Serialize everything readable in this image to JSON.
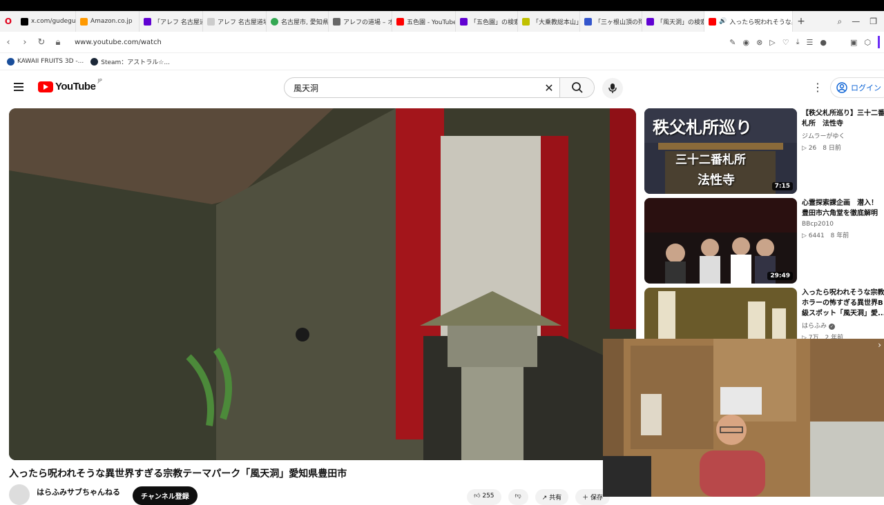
{
  "browser": {
    "tabs": [
      {
        "label": "x.com/gudegude",
        "color": "#000000"
      },
      {
        "label": "Amazon.co.jp",
        "color": "#ff9900"
      },
      {
        "label": "「アレフ 名古屋道場」",
        "color": "#6001d2"
      },
      {
        "label": "アレフ 名古屋道場",
        "color": "#e0e0e0"
      },
      {
        "label": "名古屋市, 愛知県",
        "color": "#34a853"
      },
      {
        "label": "アレフの道場 – オウ",
        "color": "#666666"
      },
      {
        "label": "五色園 - YouTube",
        "color": "#ff0000"
      },
      {
        "label": "「五色園」の検索結",
        "color": "#6001d2"
      },
      {
        "label": "「大乗教総本山」",
        "color": "#c0c000"
      },
      {
        "label": "「三ヶ根山頂の殉国",
        "color": "#3355cc"
      },
      {
        "label": "「風天洞」の検索結",
        "color": "#6001d2"
      },
      {
        "label": "入ったら呪われそうな異世",
        "color": "#ff0000"
      }
    ],
    "url": "www.youtube.com/watch",
    "bookmarks": [
      "KAWAII FRUITS 3D -...",
      "Steam：アストラル☆..."
    ]
  },
  "youtube": {
    "logo_text": "YouTube",
    "region": "JP",
    "search_query": "風天洞",
    "login_label": "ログイン"
  },
  "video": {
    "title": "入ったら呪われそうな異世界すぎる宗教テーマパーク「風天洞」愛知県豊田市",
    "channel": "はらふみサブちゃんねる",
    "subscribe_label": "チャンネル登録",
    "like_count": "255",
    "share_label": "共有",
    "save_label": "保存"
  },
  "recommendations": [
    {
      "title_line1": "【秩父札所巡り】三十二番",
      "title_line2": "札所　法性寺",
      "channel": "ジムラーがゆく",
      "stats": "▷ 26　8 日前",
      "duration": "7:15",
      "thumb_text_line1": "秩父札所巡り",
      "thumb_text_line2": "三十二番札所",
      "thumb_text_line3": "法性寺"
    },
    {
      "title_line1": "心霊探索課企画　潜入！",
      "title_line2": "豊田市六角堂を徹底解明",
      "channel": "BBcp2010",
      "stats": "▷ 6441　8 年前",
      "duration": "29:49"
    },
    {
      "title_line1": "入ったら呪われそうな宗教",
      "title_line2": "ホラーの怖すぎる異世界B",
      "title_line3": "級スポット「風天洞」愛...",
      "channel": "はらふみ",
      "stats": "▷ 7万　2 年前"
    }
  ]
}
